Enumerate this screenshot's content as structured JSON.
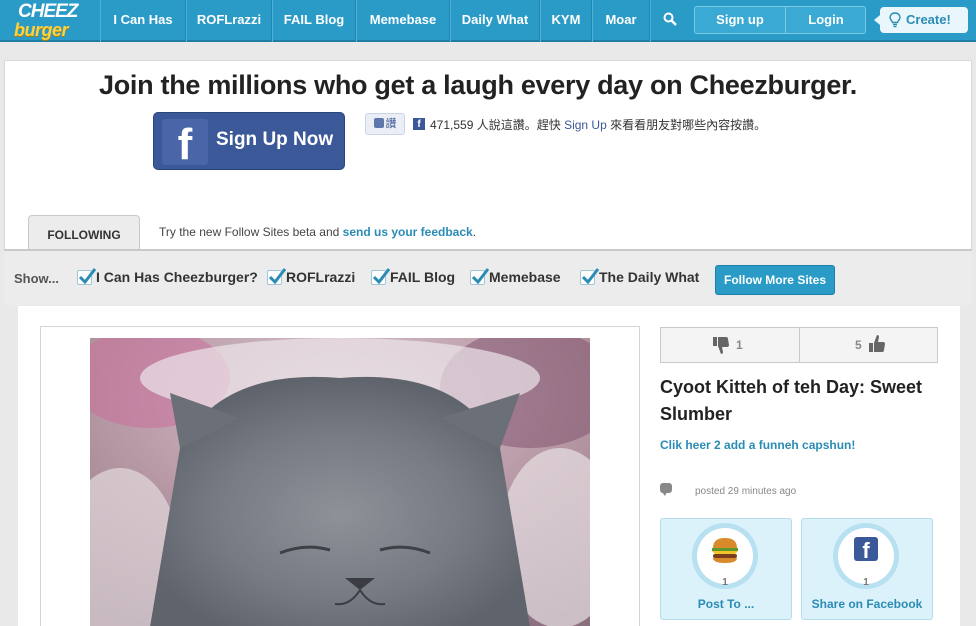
{
  "nav": {
    "logo_top": "CHEEZ",
    "logo_bottom": "burger",
    "items": [
      "I Can Has",
      "ROFLrazzi",
      "FAIL Blog",
      "Memebase",
      "Daily What",
      "KYM",
      "Moar"
    ],
    "sign_up": "Sign up",
    "login": "Login",
    "create": "Create!"
  },
  "hero": {
    "title": "Join the millions who get a laugh every day on Cheezburger.",
    "fb_button": "Sign Up Now",
    "like_button": "讚",
    "like_count": "471,559 人說這讚。趕快",
    "like_link": "Sign Up",
    "like_rest": "來看看朋友對哪些內容按讚。"
  },
  "following": {
    "tab": "FOLLOWING",
    "message": "Try the new Follow Sites beta and ",
    "feedback_link": "send us your feedback",
    "period": "."
  },
  "filters": {
    "show_label": "Show...",
    "sites": [
      "I Can Has Cheezburger?",
      "ROFLrazzi",
      "FAIL Blog",
      "Memebase",
      "The Daily What"
    ],
    "follow_more": "Follow More Sites"
  },
  "post": {
    "downvotes": "1",
    "upvotes": "5",
    "title": "Cyoot Kitteh of teh Day: Sweet Slumber",
    "caption_link": "Clik heer 2 add a funneh capshun!",
    "posted": "posted 29 minutes ago",
    "share_cards": [
      {
        "count": "1",
        "label": "Post To ..."
      },
      {
        "count": "1",
        "label": "Share on Facebook"
      }
    ]
  }
}
